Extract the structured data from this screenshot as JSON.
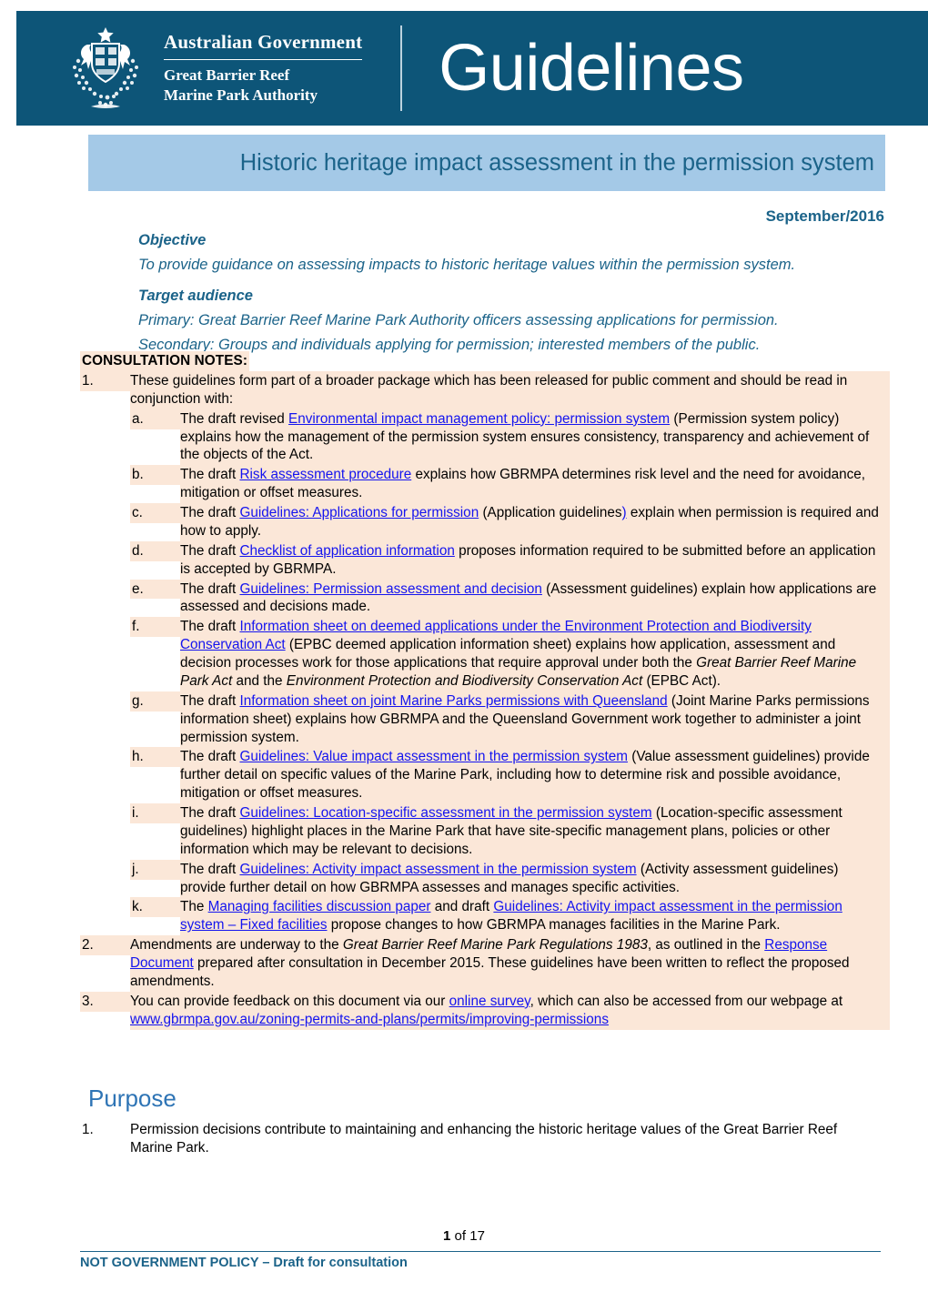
{
  "header": {
    "crest_icon": "australian-coat-of-arms",
    "government_line": "Australian Government",
    "agency_line1": "Great Barrier Reef",
    "agency_line2": "Marine Park Authority",
    "doc_type": "Guidelines",
    "band_color": "#0d5578"
  },
  "title_band": {
    "title": "Historic heritage impact assessment in the permission system",
    "background_color": "#a4c9e7",
    "text_color": "#1b6389"
  },
  "date": "September/2016",
  "intro": {
    "objective_heading": "Objective",
    "objective_text": "To provide guidance on assessing impacts to historic heritage values within the permission system.",
    "audience_heading": "Target audience",
    "audience_primary": "Primary: Great Barrier Reef Marine Park Authority officers assessing applications for permission.",
    "audience_secondary": "Secondary: Groups and individuals applying for permission; interested members of the public."
  },
  "consultation": {
    "title": "CONSULTATION NOTES:",
    "highlight_color": "#fbe7d8",
    "link_color": "#1414ef",
    "item1": {
      "num": "1.",
      "text": "These guidelines form part of a broader package which has been released for public comment and should be read in conjunction with:"
    },
    "sub_items": [
      {
        "letter": "a.",
        "pre": "The draft revised ",
        "link": "Environmental impact management policy: permission system",
        "post": " (Permission system policy) explains how the management of the permission system ensures consistency, transparency and achievement of the objects of the Act."
      },
      {
        "letter": "b.",
        "pre": "The draft ",
        "link": "Risk assessment procedure",
        "post": " explains how GBRMPA determines risk level and the need for avoidance, mitigation or offset measures."
      },
      {
        "letter": "c.",
        "pre": "The draft ",
        "link": "Guidelines: Applications for permission",
        "post": " (Application guidelines",
        "post_link": ")",
        "post2": " explain when permission is required and how to apply."
      },
      {
        "letter": "d.",
        "pre": "The draft ",
        "link": "Checklist of application information",
        "post": " proposes information required to be submitted before an application is accepted by GBRMPA."
      },
      {
        "letter": "e.",
        "pre": "The draft ",
        "link": "Guidelines: Permission assessment and decision",
        "post": " (Assessment guidelines) explain how applications are assessed and decisions made."
      },
      {
        "letter": "f.",
        "pre": "The draft ",
        "link": "Information sheet on deemed applications under the Environment Protection and Biodiversity Conservation Act",
        "post": " (EPBC deemed application information sheet) explains how application, assessment and decision processes work for those applications that require approval under both the ",
        "italic1": "Great Barrier Reef Marine Park Act",
        "mid": " and the ",
        "italic2": "Environment Protection and Biodiversity Conservation Act",
        "tail": " (EPBC Act)."
      },
      {
        "letter": "g.",
        "pre": "The draft ",
        "link": "Information sheet on joint Marine Parks permissions with Queensland",
        "post": " (Joint Marine Parks permissions information sheet) explains how GBRMPA and the Queensland Government work together to administer a joint permission system."
      },
      {
        "letter": "h.",
        "pre": "The draft ",
        "link": "Guidelines: Value impact assessment in the permission system",
        "post": " (Value assessment guidelines) provide further detail on specific values of the Marine Park, including how to determine risk and possible avoidance, mitigation or offset measures."
      },
      {
        "letter": "i.",
        "pre": "The draft ",
        "link": "Guidelines: Location-specific assessment in the permission system",
        "post": " (Location-specific assessment guidelines) highlight places in the Marine Park that have site-specific management plans, policies or other information which may be relevant to decisions."
      },
      {
        "letter": "j.",
        "pre": "The draft ",
        "link": "Guidelines: Activity impact assessment in the permission system",
        "post": " (Activity assessment guidelines) provide further detail on how GBRMPA assesses and manages specific activities."
      },
      {
        "letter": "k.",
        "pre": "The ",
        "link": "Managing facilities discussion paper",
        "post": " and draft ",
        "link2": "Guidelines: Activity impact assessment in the permission system – Fixed facilities",
        "post2": " propose changes to how GBRMPA manages facilities in the Marine Park."
      }
    ],
    "item2": {
      "num": "2.",
      "pre": "Amendments are underway to the ",
      "italic": "Great Barrier Reef Marine Park Regulations 1983",
      "mid": ", as outlined in the ",
      "link": "Response Document",
      "post": " prepared after consultation in December 2015. These guidelines have been written to reflect the proposed amendments."
    },
    "item3": {
      "num": "3.",
      "pre": "You can provide feedback on this document via our ",
      "link": "online survey",
      "mid": ", which can also be accessed from our webpage at ",
      "url": "www.gbrmpa.gov.au/zoning-permits-and-plans/permits/improving-permissions"
    }
  },
  "purpose": {
    "heading": "Purpose",
    "item_num": "1.",
    "item_text": "Permission decisions contribute to maintaining and enhancing the historic heritage values of the Great Barrier Reef Marine Park."
  },
  "footer": {
    "page_current": "1",
    "page_of": " of ",
    "page_total": "17",
    "note": "NOT GOVERNMENT POLICY – Draft for consultation",
    "accent_color": "#1b6389"
  }
}
